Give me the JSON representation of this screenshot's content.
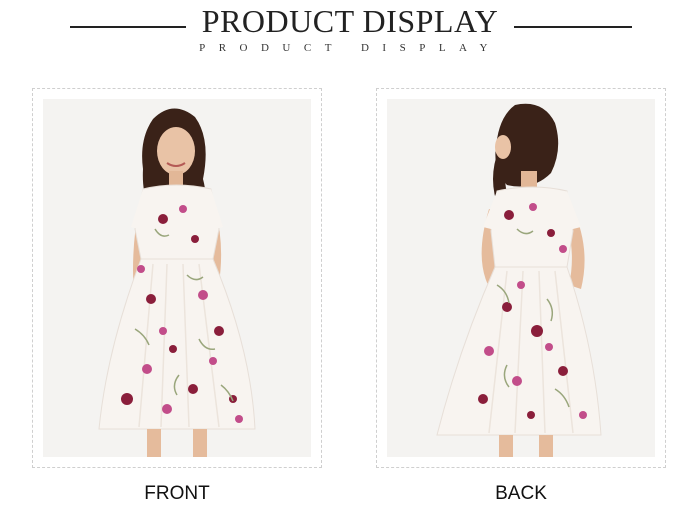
{
  "header": {
    "title": "PRODUCT DISPLAY",
    "subtitle": "PRODUCT DISPLAY"
  },
  "views": [
    {
      "label": "FRONT",
      "photo": "model-front-view"
    },
    {
      "label": "BACK",
      "photo": "model-back-view"
    }
  ],
  "colors": {
    "dress": "#f8f4f0",
    "floral_primary": "#8a1e3b",
    "floral_secondary": "#c24d8a",
    "leaf": "#9aa67c",
    "background": "#f4f3f1"
  }
}
